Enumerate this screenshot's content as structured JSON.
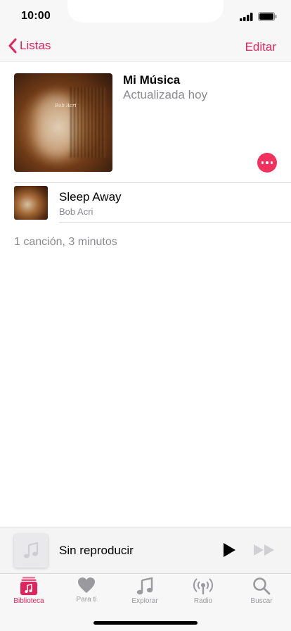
{
  "status": {
    "time": "10:00"
  },
  "nav": {
    "back_label": "Listas",
    "edit_label": "Editar"
  },
  "playlist": {
    "title": "Mi Música",
    "subtitle": "Actualizada hoy",
    "artwork_text": "Bob Acri"
  },
  "songs": [
    {
      "title": "Sleep Away",
      "artist": "Bob Acri"
    }
  ],
  "summary": "1 canción, 3 minutos",
  "mini_player": {
    "title": "Sin reproducir"
  },
  "tabs": [
    {
      "label": "Biblioteca",
      "icon": "library-icon",
      "active": true
    },
    {
      "label": "Para ti",
      "icon": "heart-icon",
      "active": false
    },
    {
      "label": "Explorar",
      "icon": "music-note-icon",
      "active": false
    },
    {
      "label": "Radio",
      "icon": "radio-icon",
      "active": false
    },
    {
      "label": "Buscar",
      "icon": "search-icon",
      "active": false
    }
  ],
  "colors": {
    "accent": "#e0245e",
    "more_button": "#f2315e",
    "secondary_text": "#8a8a8e",
    "inactive_tab": "#9a9a9e"
  }
}
